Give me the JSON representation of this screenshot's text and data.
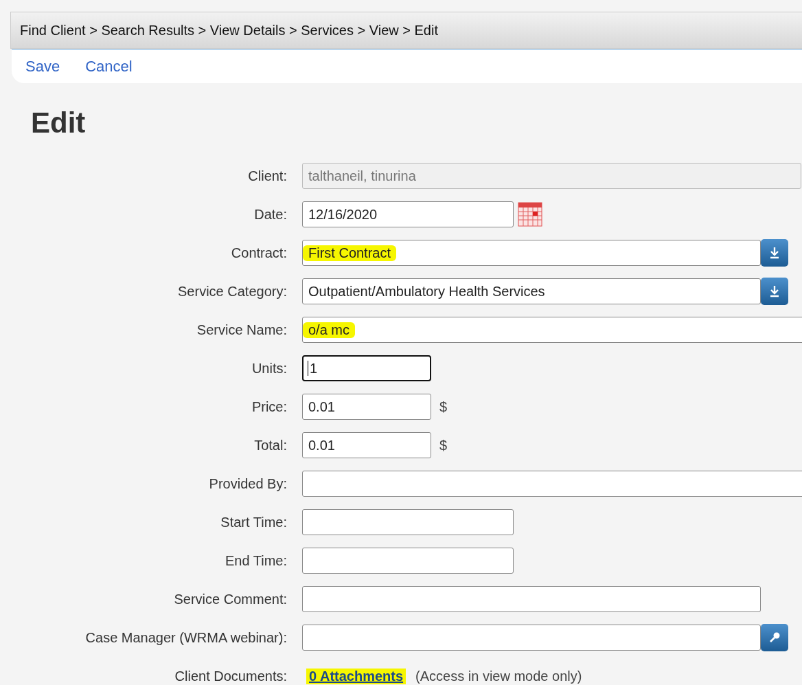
{
  "breadcrumb": "Find Client > Search Results > View Details > Services > View > Edit",
  "actions": [
    "Save",
    "Cancel"
  ],
  "title": "Edit",
  "fields": [
    {
      "label": "Client:",
      "kind": "readonly",
      "value": "talthaneil, tinurina",
      "highlighted": false
    },
    {
      "label": "Date:",
      "kind": "date",
      "value": "12/16/2020",
      "highlighted": false,
      "focused": false
    },
    {
      "label": "Contract:",
      "kind": "select",
      "value": "First Contract",
      "highlighted": true,
      "focused": false
    },
    {
      "label": "Service Category:",
      "kind": "select",
      "value": "Outpatient/Ambulatory Health Services",
      "highlighted": false,
      "focused": false
    },
    {
      "label": "Service Name:",
      "kind": "wide",
      "value": "o/a mc",
      "highlighted": true,
      "focused": false
    },
    {
      "label": "Units:",
      "kind": "small",
      "value": "1",
      "highlighted": false,
      "focused": true
    },
    {
      "label": "Price:",
      "kind": "money",
      "value": "0.01",
      "unit": "$",
      "highlighted": false,
      "focused": false
    },
    {
      "label": "Total:",
      "kind": "money",
      "value": "0.01",
      "unit": "$",
      "highlighted": false,
      "focused": false
    },
    {
      "label": "Provided By:",
      "kind": "wide",
      "focused": false
    },
    {
      "label": "Start Time:",
      "kind": "medium",
      "focused": false
    },
    {
      "label": "End Time:",
      "kind": "medium",
      "focused": false
    },
    {
      "label": "Service Comment:",
      "kind": "comment",
      "focused": false
    },
    {
      "label": "Case Manager (WRMA webinar):",
      "kind": "lookup",
      "focused": false
    },
    {
      "label": "Client Documents:",
      "kind": "attachments",
      "value": "0 Attachments",
      "note": "(Access in view mode only)",
      "highlighted": true
    }
  ]
}
